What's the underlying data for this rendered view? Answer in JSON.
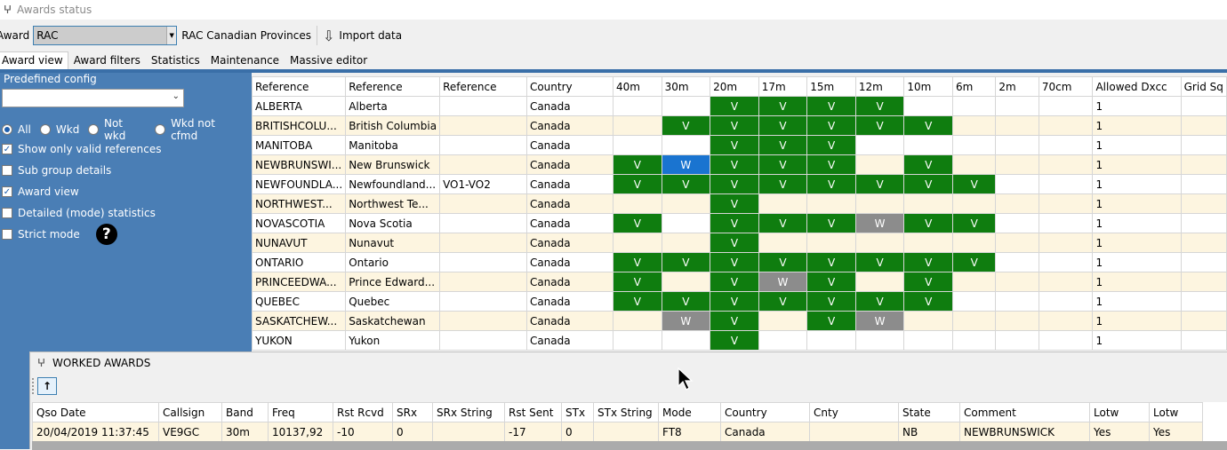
{
  "window": {
    "title": "Awards status"
  },
  "toolbar": {
    "award_label": "Award",
    "award_value": "RAC",
    "award_name": "RAC Canadian Provinces",
    "import_label": "Import data"
  },
  "tabs": [
    "Award view",
    "Award filters",
    "Statistics",
    "Maintenance",
    "Massive editor"
  ],
  "left_panel": {
    "predefined_label": "Predefined config",
    "predefined_value": "",
    "radios": [
      {
        "label": "All",
        "selected": true
      },
      {
        "label": "Wkd",
        "selected": false
      },
      {
        "label": "Not wkd",
        "selected": false
      },
      {
        "label": "Wkd not cfmd",
        "selected": false
      }
    ],
    "checks": [
      {
        "label": "Show only valid references",
        "checked": true
      },
      {
        "label": "Sub group details",
        "checked": false
      },
      {
        "label": "Award view",
        "checked": true
      },
      {
        "label": "Detailed (mode) statistics",
        "checked": false
      },
      {
        "label": "Strict mode",
        "checked": false
      }
    ],
    "help_label": "?"
  },
  "grid": {
    "columns": [
      "Reference",
      "Reference",
      "Reference",
      "Country",
      "40m",
      "30m",
      "20m",
      "17m",
      "15m",
      "12m",
      "10m",
      "6m",
      "2m",
      "70cm",
      "Allowed Dxcc",
      "Grid Sq"
    ],
    "rows": [
      {
        "c": [
          "ALBERTA",
          "Alberta",
          "",
          "Canada",
          "",
          "",
          "V",
          "V",
          "V",
          "V",
          "",
          "",
          "",
          "",
          "1",
          ""
        ],
        "blue": []
      },
      {
        "c": [
          "BRITISHCOLU...",
          "British Columbia",
          "",
          "Canada",
          "",
          "V",
          "V",
          "V",
          "V",
          "V",
          "V",
          "",
          "",
          "",
          "1",
          ""
        ],
        "blue": []
      },
      {
        "c": [
          "MANITOBA",
          "Manitoba",
          "",
          "Canada",
          "",
          "",
          "V",
          "V",
          "V",
          "",
          "",
          "",
          "",
          "",
          "1",
          ""
        ],
        "blue": []
      },
      {
        "c": [
          "NEWBRUNSWI...",
          "New Brunswick",
          "",
          "Canada",
          "V",
          "W",
          "V",
          "V",
          "V",
          "",
          "V",
          "",
          "",
          "",
          "1",
          ""
        ],
        "blue": [
          5
        ]
      },
      {
        "c": [
          "NEWFOUNDLA...",
          "Newfoundland...",
          "VO1-VO2",
          "Canada",
          "V",
          "V",
          "V",
          "V",
          "V",
          "V",
          "V",
          "V",
          "",
          "",
          "1",
          ""
        ],
        "blue": []
      },
      {
        "c": [
          "NORTHWEST...",
          "Northwest Te...",
          "",
          "Canada",
          "",
          "",
          "V",
          "",
          "",
          "",
          "",
          "",
          "",
          "",
          "1",
          ""
        ],
        "blue": []
      },
      {
        "c": [
          "NOVASCOTIA",
          "Nova Scotia",
          "",
          "Canada",
          "V",
          "",
          "V",
          "V",
          "V",
          "W",
          "V",
          "V",
          "",
          "",
          "1",
          ""
        ],
        "blue": []
      },
      {
        "c": [
          "NUNAVUT",
          "Nunavut",
          "",
          "Canada",
          "",
          "",
          "V",
          "",
          "",
          "",
          "",
          "",
          "",
          "",
          "1",
          ""
        ],
        "blue": []
      },
      {
        "c": [
          "ONTARIO",
          "Ontario",
          "",
          "Canada",
          "V",
          "V",
          "V",
          "V",
          "V",
          "V",
          "V",
          "V",
          "",
          "",
          "1",
          ""
        ],
        "blue": []
      },
      {
        "c": [
          "PRINCEEDWA...",
          "Prince Edward...",
          "",
          "Canada",
          "V",
          "",
          "V",
          "W",
          "V",
          "",
          "V",
          "",
          "",
          "",
          "1",
          ""
        ],
        "blue": []
      },
      {
        "c": [
          "QUEBEC",
          "Quebec",
          "",
          "Canada",
          "V",
          "V",
          "V",
          "V",
          "V",
          "V",
          "V",
          "",
          "",
          "",
          "1",
          ""
        ],
        "blue": []
      },
      {
        "c": [
          "SASKATCHEW...",
          "Saskatchewan",
          "",
          "Canada",
          "",
          "W",
          "V",
          "",
          "V",
          "W",
          "",
          "",
          "",
          "",
          "1",
          ""
        ],
        "blue": []
      },
      {
        "c": [
          "YUKON",
          "Yukon",
          "",
          "Canada",
          "",
          "",
          "V",
          "",
          "",
          "",
          "",
          "",
          "",
          "",
          "1",
          ""
        ],
        "blue": []
      }
    ]
  },
  "worked": {
    "title": "WORKED AWARDS",
    "up_label": "↑",
    "columns": [
      "Qso Date",
      "Callsign",
      "Band",
      "Freq",
      "Rst Rcvd",
      "SRx",
      "SRx String",
      "Rst Sent",
      "STx",
      "STx String",
      "Mode",
      "Country",
      "Cnty",
      "State",
      "Comment",
      "Lotw",
      "Lotw"
    ],
    "rows": [
      [
        "20/04/2019 11:37:45",
        "VE9GC",
        "30m",
        "10137,92",
        "-10",
        "0",
        "",
        "-17",
        "0",
        "",
        "FT8",
        "Canada",
        "",
        "NB",
        "NEWBRUNSWICK",
        "Yes",
        "Yes"
      ]
    ]
  },
  "colors": {
    "confirmed": "#0f7d0f",
    "worked": "#8c8c8c",
    "selected": "#1a74d0",
    "panel": "#4a7eb5"
  }
}
